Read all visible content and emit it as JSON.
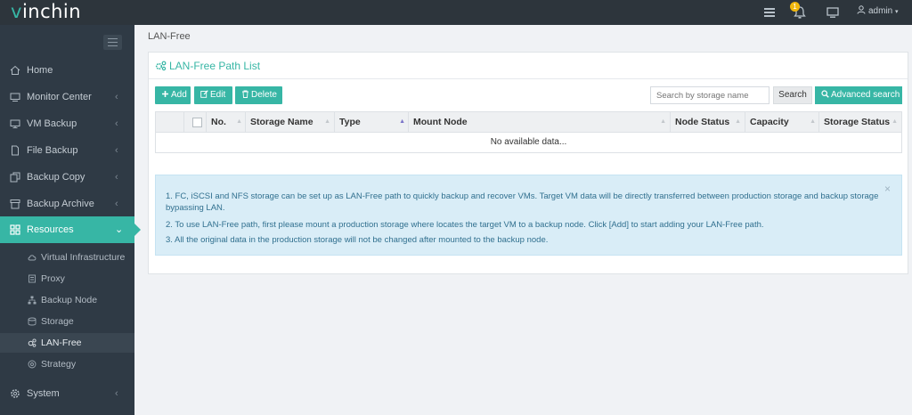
{
  "app": {
    "logo_prefix": "v",
    "logo_rest": "inchin",
    "notification_count": "1",
    "user": "admin"
  },
  "sidebar": {
    "items": [
      {
        "label": "Home",
        "icon": "home-icon"
      },
      {
        "label": "Monitor Center",
        "icon": "monitor-icon"
      },
      {
        "label": "VM Backup",
        "icon": "desktop-icon"
      },
      {
        "label": "File Backup",
        "icon": "file-icon"
      },
      {
        "label": "Backup Copy",
        "icon": "copy-icon"
      },
      {
        "label": "Backup Archive",
        "icon": "archive-icon"
      },
      {
        "label": "Resources",
        "icon": "grid-icon"
      },
      {
        "label": "System",
        "icon": "gear-icon"
      }
    ],
    "resources_sub": [
      {
        "label": "Virtual Infrastructure",
        "icon": "cloud-icon"
      },
      {
        "label": "Proxy",
        "icon": "proxy-icon"
      },
      {
        "label": "Backup Node",
        "icon": "sitemap-icon"
      },
      {
        "label": "Storage",
        "icon": "storage-icon"
      },
      {
        "label": "LAN-Free",
        "icon": "cogs-icon"
      },
      {
        "label": "Strategy",
        "icon": "strategy-icon"
      }
    ]
  },
  "breadcrumb": "LAN-Free",
  "panel": {
    "title": "LAN-Free Path List",
    "toolbar": {
      "add": "Add",
      "edit": "Edit",
      "delete": "Delete",
      "search_placeholder": "Search by storage name",
      "search": "Search",
      "advanced_search": "Advanced search"
    },
    "columns": [
      "No.",
      "Storage Name",
      "Type",
      "Mount Node",
      "Node Status",
      "Capacity",
      "Storage Status"
    ],
    "empty_text": "No available data...",
    "info": [
      "1. FC, iSCSI and NFS storage can be set up as LAN-Free path to quickly backup and recover VMs. Target VM data will be directly transferred between production storage and backup storage bypassing LAN.",
      "2. To use LAN-Free path, first please mount a production storage where locates the target VM to a backup node. Click [Add] to start adding your LAN-Free path.",
      "3. All the original data in the production storage will not be changed after mounted to the backup node."
    ]
  },
  "colors": {
    "accent": "#37b6a5",
    "sidebar_bg": "#2f3a45",
    "topbar_bg": "#2d353c",
    "info_bg": "#d9edf7",
    "info_text": "#31708f"
  }
}
